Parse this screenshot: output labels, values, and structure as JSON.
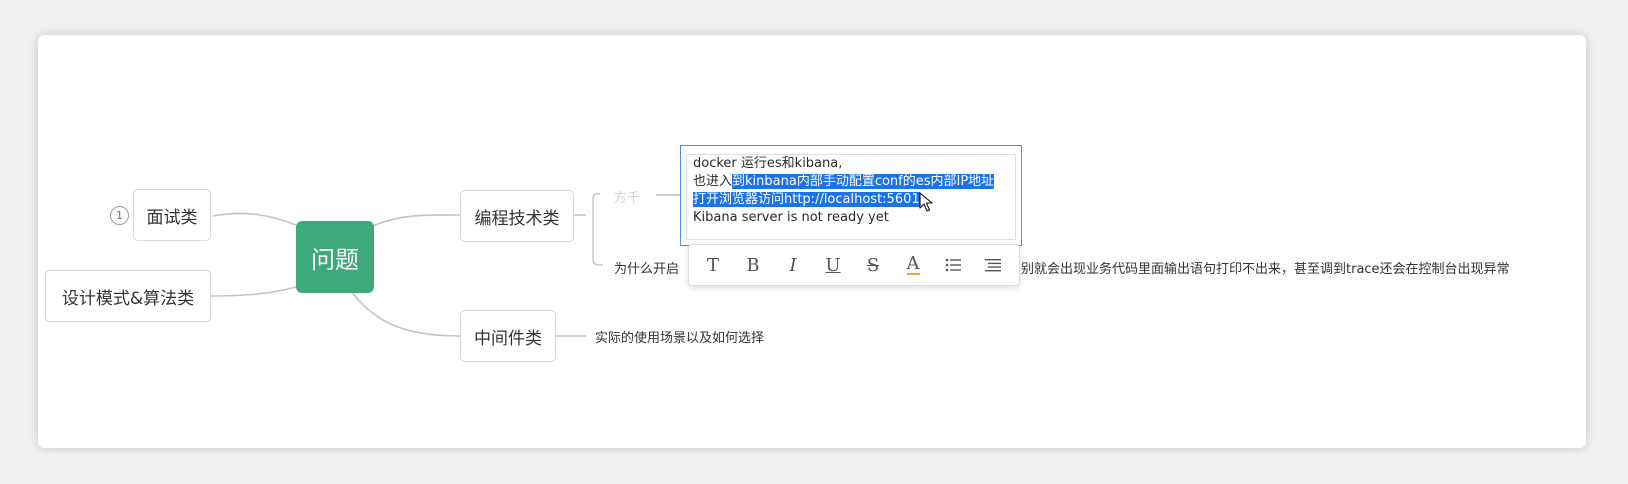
{
  "mindmap": {
    "root": {
      "label": "问题"
    },
    "left_topics": [
      {
        "label": "面试类",
        "badge": "1"
      },
      {
        "label": "设计模式&算法类"
      }
    ],
    "right_topics": [
      {
        "label": "编程技术类"
      },
      {
        "label": "中间件类"
      }
    ],
    "leaves": {
      "faded_placeholder": "方千",
      "question_left": "为什么开启",
      "question_right": "别就会出现业务代码里面输出语句打印不出来，甚至调到trace还会在控制台出现异常",
      "middleware_child": "实际的使用场景以及如何选择"
    }
  },
  "editor": {
    "line1": "docker 运行es和kibana,",
    "line2_prefix": "也进入",
    "line2_selected": "到kinbana内部手动配置conf的es内部IP地址",
    "line3_selected": "打开浏览器访问http://localhost:5601",
    "line4": "Kibana server is not ready yet"
  },
  "toolbar": {
    "text": "T",
    "bold": "B",
    "italic": "I",
    "underline": "U",
    "strike": "S",
    "color_letter": "A",
    "color_accent": "#f5a623"
  },
  "colors": {
    "root": "#3ea97a",
    "selection": "#1a73e8",
    "editor_border": "#4a90e2"
  }
}
